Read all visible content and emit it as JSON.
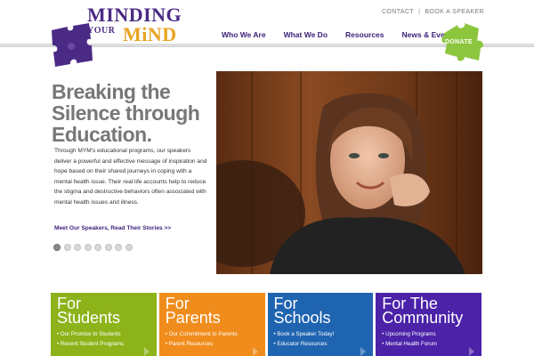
{
  "logo": {
    "line1": "MINDING",
    "your": "YOUR",
    "mind": "MiND"
  },
  "util_nav": {
    "contact": "CONTACT",
    "separator": "|",
    "book": "BOOK A SPEAKER"
  },
  "main_nav": [
    "Who We Are",
    "What We Do",
    "Resources",
    "News & Events"
  ],
  "donate": {
    "label": "DONATE"
  },
  "hero": {
    "title_lines": [
      "Breaking the",
      "Silence through",
      "Education."
    ],
    "body": "Through MYM's educational programs, our speakers deliver a powerful and effective message of inspiration and hope based on their shared journeys in coping with a mental health issue.  Their real life accounts help to reduce the stigma and destructive behaviors often associated with mental health issues and illness.",
    "link": "Meet Our Speakers, Read Their Stories >>",
    "slide_count": 8,
    "active_slide": 1
  },
  "tiles": [
    {
      "for": "For",
      "name": "Students",
      "color": "#8cb319",
      "links": [
        "Our Promise to Students",
        "Recent Student Programs"
      ]
    },
    {
      "for": "For",
      "name": "Parents",
      "color": "#f08c1c",
      "links": [
        "Our Commitment to Parents",
        "Parent Resources"
      ]
    },
    {
      "for": "For",
      "name": "Schools",
      "color": "#1f64b0",
      "links": [
        "Book a Speaker Today!",
        "Educator Resources"
      ]
    },
    {
      "for": "For The",
      "name": "Community",
      "color": "#4b22a8",
      "links": [
        "Upcoming Programs",
        "Mental Health Forum"
      ]
    }
  ],
  "colors": {
    "brand_purple": "#4b2a86",
    "brand_gold": "#e9a322",
    "donate_green": "#8cc63f"
  }
}
